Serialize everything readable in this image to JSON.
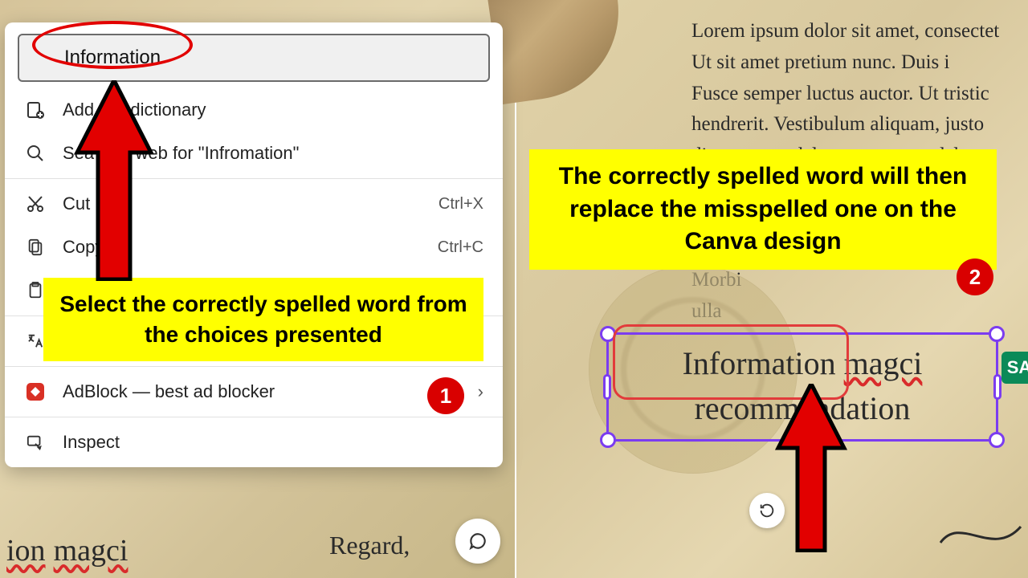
{
  "context_menu": {
    "suggestion": "Information",
    "add_dictionary_before": "Add ",
    "add_dictionary_after": " dictionary",
    "search_web_before": "Sea",
    "search_web_after": "e web for \"Infromation\"",
    "cut_label": "Cut",
    "cut_shortcut": "Ctrl+X",
    "copy_label": "Copy",
    "copy_shortcut": "Ctrl+C",
    "translate_label": "Translate selection to English",
    "adblock_label": "AdBlock — best ad blocker",
    "inspect_label": "Inspect"
  },
  "callouts": {
    "left": "Select the correctly spelled word from the choices presented",
    "right": "The correctly spelled word will then replace the misspelled one on the Canva design"
  },
  "steps": {
    "one": "1",
    "two": "2"
  },
  "left_canvas": {
    "misspelled_word": "ion",
    "misspelled_word2": "magci",
    "regard": "Regard,"
  },
  "right_canvas": {
    "body": "Lorem ipsum dolor sit amet, consectet\nUt sit amet pretium nunc. Duis i\nFusce semper luctus auctor. Ut tristic\nhendrerit. Vestibulum aliquam, justo\ndiam eros sodales neque, at sodales m\nque du\ntempor tris\nsit am\nMorbi\nulla",
    "line1_word1": "Information",
    "line1_word2": "magci",
    "line2": "recommendation",
    "sa_badge": "SA"
  }
}
